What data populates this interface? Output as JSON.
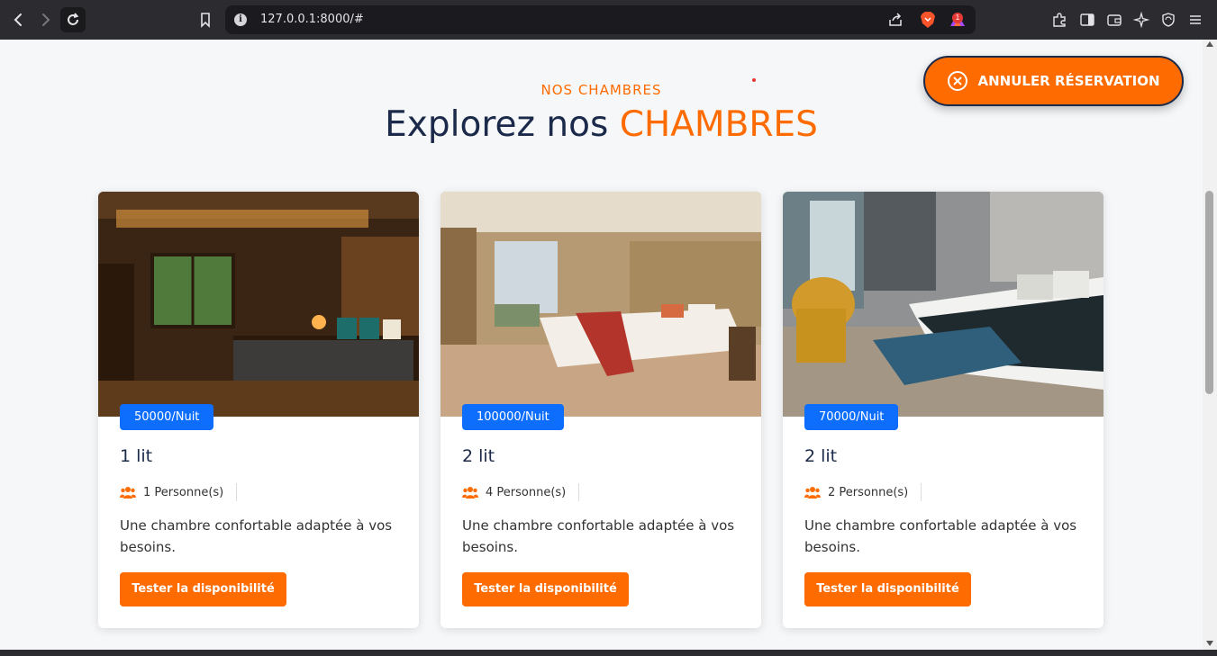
{
  "browser": {
    "url": "127.0.0.1:8000/#",
    "notification_count": "1"
  },
  "section": {
    "subtitle": "NOS CHAMBRES",
    "title_prefix": "Explorez nos",
    "title_accent": "CHAMBRES"
  },
  "cancel_button": {
    "label": "ANNULER RÉSERVATION"
  },
  "rooms": [
    {
      "price": "50000/Nuit",
      "beds": "1 lit",
      "persons": "1 Personne(s)",
      "description": "Une chambre confortable adaptée à vos besoins.",
      "button": "Tester la disponibilité"
    },
    {
      "price": "100000/Nuit",
      "beds": "2 lit",
      "persons": "4 Personne(s)",
      "description": "Une chambre confortable adaptée à vos besoins.",
      "button": "Tester la disponibilité"
    },
    {
      "price": "70000/Nuit",
      "beds": "2 lit",
      "persons": "2 Personne(s)",
      "description": "Une chambre confortable adaptée à vos besoins.",
      "button": "Tester la disponibilité"
    }
  ],
  "colors": {
    "accent": "#fe6b00",
    "price_badge": "#0d6efd",
    "title_dark": "#1b2a4a"
  },
  "icons": [
    "back-icon",
    "forward-icon",
    "reload-icon",
    "bookmark-icon",
    "info-icon",
    "share-icon",
    "brave-shield-icon",
    "brave-rewards-icon",
    "extensions-icon",
    "sidebar-icon",
    "wallet-icon",
    "leo-icon",
    "vpn-icon",
    "menu-icon",
    "close-circle-icon",
    "users-icon"
  ]
}
